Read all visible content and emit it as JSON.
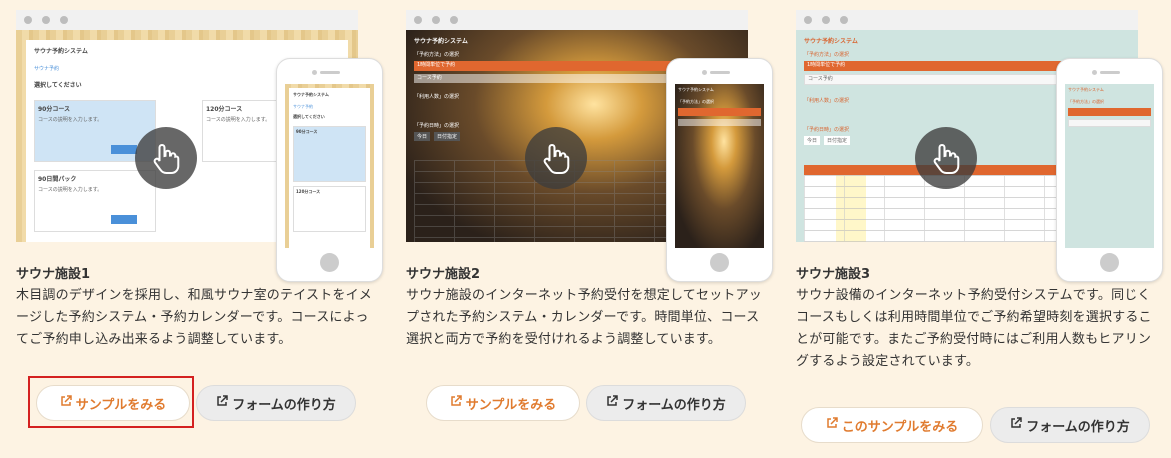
{
  "facilities": [
    {
      "title": "サウナ施設1",
      "description": "木目調のデザインを採用し、和風サウナ室のテイストをイメージした予約システム・予約カレンダーです。コースによってご予約申し込み出来るよう調整しています。",
      "sample_label": "サンプルをみる",
      "form_label": "フォームの作り方",
      "preview": {
        "app_title": "サウナ予約システム",
        "menu": "サウナ予約",
        "prompt": "選択してください",
        "course_a": "90分コース",
        "course_b": "120分コース",
        "course_c": "90日間パック",
        "course_text": "コースの説明を入力します。",
        "select_label": "選択する"
      }
    },
    {
      "title": "サウナ施設2",
      "description": "サウナ施設のインターネット予約受付を想定してセットアップされた予約システム・カレンダーです。時間単位、コース選択と両方で予約を受付けれるよう調整しています。",
      "sample_label": "サンプルをみる",
      "form_label": "フォームの作り方",
      "preview": {
        "app_title": "サウナ予約システム",
        "step1": "「予約方法」の選択",
        "opt1": "1時間単位で予約",
        "opt2": "コース予約",
        "step2": "「利用人数」の選択",
        "step3": "「予約日時」の選択",
        "today": "今日",
        "date_pick": "日付指定"
      }
    },
    {
      "title": "サウナ施設3",
      "description": "サウナ設備のインターネット予約受付システムです。同じくコースもしくは利用時間単位でご予約希望時刻を選択することが可能です。またご予約受付時にはご利用人数もヒアリングするよう設定されています。",
      "sample_label": "このサンプルをみる",
      "form_label": "フォームの作り方",
      "preview": {
        "app_title": "サウナ予約システム",
        "step1": "「予約方法」の選択",
        "opt1": "1時間単位で予約",
        "opt2": "コース予約",
        "step2": "「利用人数」の選択",
        "step3": "「予約日時」の選択",
        "today": "今日",
        "date_pick": "日付指定"
      }
    }
  ],
  "colors": {
    "background": "#fdf3e3",
    "accent_orange": "#e07b2f",
    "highlight_red": "#d42020"
  },
  "icons": {
    "hand": "hand-pointer-icon",
    "external": "external-link-icon"
  }
}
